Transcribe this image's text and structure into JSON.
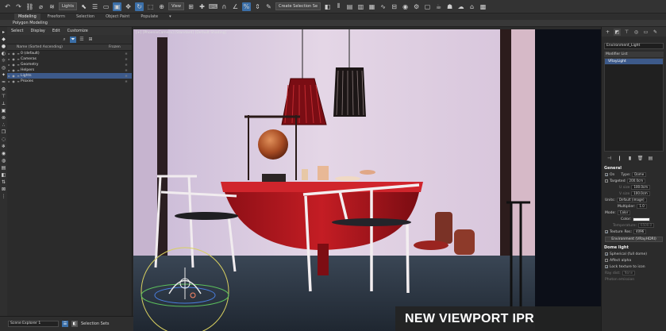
{
  "toolbar": {
    "filter_dropdown": "Lights",
    "view_dropdown": "View",
    "selection_set_dropdown": "Create Selection Se"
  },
  "ribbon": {
    "tabs": [
      "Modeling",
      "Freeform",
      "Selection",
      "Object Paint",
      "Populate"
    ],
    "active_tab": "Modeling",
    "sub_label": "Polygon Modeling"
  },
  "scene_explorer": {
    "menu": [
      "Select",
      "Display",
      "Edit",
      "Customize"
    ],
    "header_name": "Name (Sorted Ascending)",
    "header_frozen": "Frozen",
    "rows": [
      {
        "label": "0 (default)",
        "selected": false
      },
      {
        "label": "Cameras",
        "selected": false
      },
      {
        "label": "Geometry",
        "selected": false
      },
      {
        "label": "Helpers",
        "selected": false
      },
      {
        "label": "Lights",
        "selected": true
      },
      {
        "label": "Proxies",
        "selected": false
      }
    ]
  },
  "viewport": {
    "label": "[+] [PhoenixCamera] [Standard] [Default Shading]",
    "banner": "NEW VIEWPORT IPR"
  },
  "command_panel": {
    "object_name": "Environment_Light",
    "modifier_list_label": "Modifier List",
    "stack_item": "VRayLight",
    "general_title": "General",
    "on_label": "On",
    "type_label": "Type:",
    "type_value": "Dome",
    "targeted_label": "Targeted",
    "targeted_value": "200.0cm",
    "length_label": "U size",
    "length_value": "100.0cm",
    "width_label": "V size",
    "width_value": "100.0cm",
    "units_label": "Units:",
    "units_value": "Default (image)",
    "multiplier_label": "Multiplier:",
    "multiplier_value": "1.0",
    "mode_label": "Mode:",
    "mode_value": "Color",
    "color_label": "Color:",
    "temperature_label": "Temperature:",
    "temperature_value": "6500.0",
    "texture_label": "Texture",
    "res_label": "Res:",
    "res_value": "4096",
    "texture_button": "Environment (VRayHDRI)",
    "dome_title": "Dome light",
    "spherical_label": "Spherical (full dome)",
    "affect_alpha_label": "Affect alpha",
    "lock_texture_label": "Lock texture to icon",
    "ray_dist_label": "Ray dist:",
    "ray_dist_value": "None",
    "photon_emission_label": "Photon emission"
  },
  "bottom_bar": {
    "explorer_name": "Scene Explorer 1",
    "selection_sets_label": "Selection Sets"
  },
  "colors": {
    "accent_blue": "#3b6fa8",
    "selection_blue": "#3d5a8a",
    "table_red": "#b3141c",
    "wall_pink": "#d9c9df"
  }
}
